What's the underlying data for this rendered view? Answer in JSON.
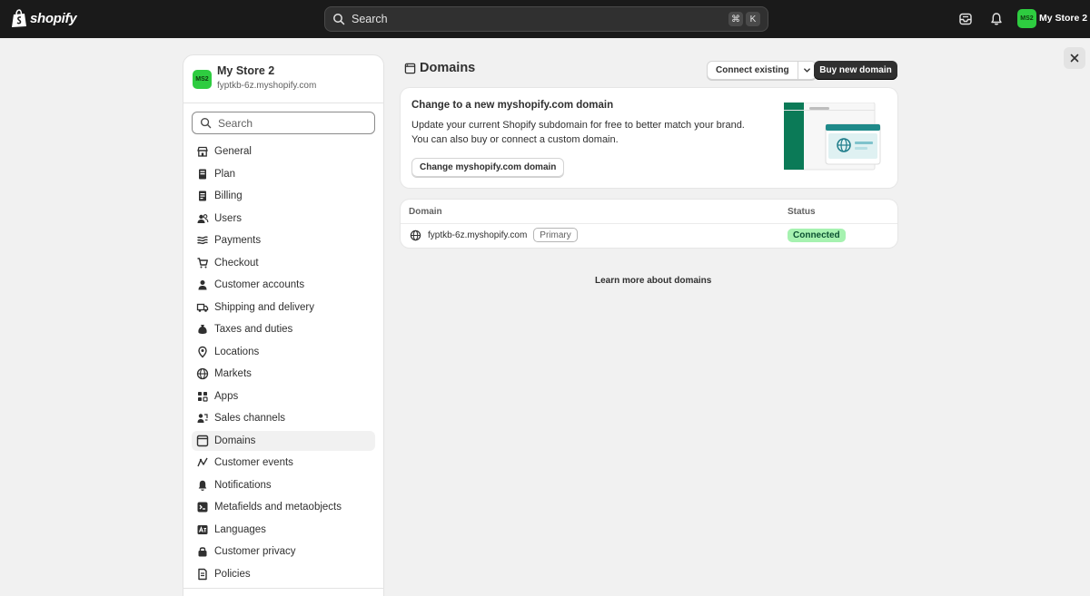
{
  "topbar": {
    "brand": "shopify",
    "search_label": "Search",
    "shortcut_keys": [
      "⌘",
      "K"
    ],
    "store_initials": "MS2",
    "store_name": "My Store 2"
  },
  "sidebar": {
    "store_initials": "MS2",
    "store_name": "My Store 2",
    "store_domain": "fyptkb-6z.myshopify.com",
    "search_placeholder": "Search",
    "items": [
      {
        "label": "General",
        "icon": "store-icon"
      },
      {
        "label": "Plan",
        "icon": "plan-icon"
      },
      {
        "label": "Billing",
        "icon": "billing-icon"
      },
      {
        "label": "Users",
        "icon": "users-icon"
      },
      {
        "label": "Payments",
        "icon": "payments-icon"
      },
      {
        "label": "Checkout",
        "icon": "cart-icon"
      },
      {
        "label": "Customer accounts",
        "icon": "person-icon"
      },
      {
        "label": "Shipping and delivery",
        "icon": "truck-icon"
      },
      {
        "label": "Taxes and duties",
        "icon": "money-bag-icon"
      },
      {
        "label": "Locations",
        "icon": "location-icon"
      },
      {
        "label": "Markets",
        "icon": "globe-icon"
      },
      {
        "label": "Apps",
        "icon": "apps-icon"
      },
      {
        "label": "Sales channels",
        "icon": "channels-icon"
      },
      {
        "label": "Domains",
        "icon": "domain-icon",
        "active": true
      },
      {
        "label": "Customer events",
        "icon": "events-icon"
      },
      {
        "label": "Notifications",
        "icon": "bell-icon"
      },
      {
        "label": "Metafields and metaobjects",
        "icon": "metafields-icon"
      },
      {
        "label": "Languages",
        "icon": "language-icon"
      },
      {
        "label": "Customer privacy",
        "icon": "lock-icon"
      },
      {
        "label": "Policies",
        "icon": "policy-icon"
      }
    ]
  },
  "main": {
    "title": "Domains",
    "connect_label": "Connect existing",
    "buy_label": "Buy new domain",
    "promo": {
      "title": "Change to a new myshopify.com domain",
      "line1": "Update your current Shopify subdomain for free to better match your brand.",
      "line2": "You can also buy or connect a custom domain.",
      "button": "Change myshopify.com domain"
    },
    "table": {
      "col_domain": "Domain",
      "col_status": "Status",
      "rows": [
        {
          "domain": "fyptkb-6z.myshopify.com",
          "badge": "Primary",
          "status": "Connected"
        }
      ]
    },
    "learn_more": "Learn more about domains"
  },
  "colors": {
    "topbar": "#1a1a1a",
    "avatar": "#2ecc40",
    "connected_bg": "#a6f2b0",
    "connected_text": "#0c5132",
    "primary_button": "#303030"
  }
}
